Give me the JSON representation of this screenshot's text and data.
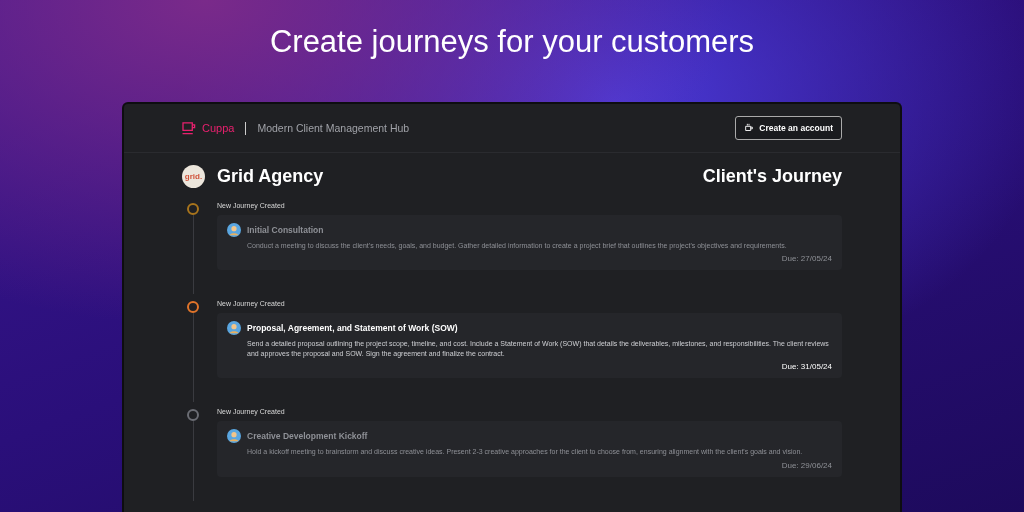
{
  "headline": "Create journeys for your customers",
  "app": {
    "brand": "Cuppa",
    "tagline": "Modern Client Management Hub",
    "cta": "Create an account"
  },
  "client": {
    "logo_text": "grid.",
    "name": "Grid Agency",
    "page_title": "Client's Journey"
  },
  "steps": [
    {
      "event": "New Journey Created",
      "color": "#a8741c",
      "active": false,
      "title": "Initial Consultation",
      "description": "Conduct a meeting to discuss the client's needs, goals, and budget. Gather detailed information to create a project brief that outlines the project's objectives and requirements.",
      "due": "Due: 27/05/24"
    },
    {
      "event": "New Journey Created",
      "color": "#e0742a",
      "active": true,
      "title": "Proposal, Agreement, and Statement of Work (SOW)",
      "description": "Send a detailed proposal outlining the project scope, timeline, and cost. Include a Statement of Work (SOW) that details the deliverables, milestones, and responsibilities. The client reviews and approves the proposal and SOW. Sign the agreement and finalize the contract.",
      "due": "Due: 31/05/24"
    },
    {
      "event": "New Journey Created",
      "color": "#6b6d74",
      "active": false,
      "title": "Creative Development Kickoff",
      "description": "Hold a kickoff meeting to brainstorm and discuss creative ideas. Present 2-3 creative approaches for the client to choose from, ensuring alignment with the client's goals and vision.",
      "due": "Due: 29/06/24"
    }
  ]
}
